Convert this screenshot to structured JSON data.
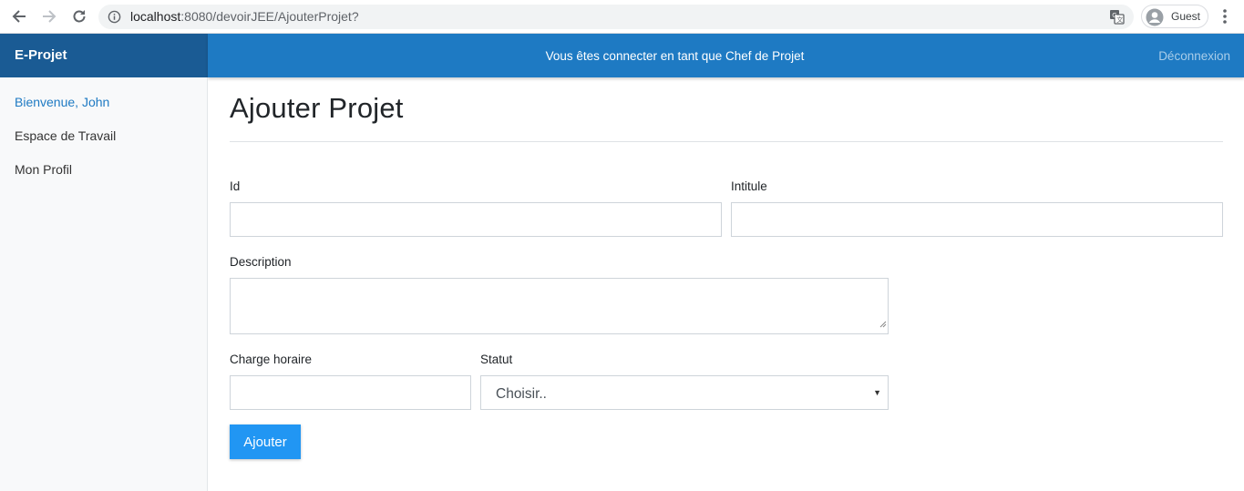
{
  "browser": {
    "url_host": "localhost",
    "url_path": ":8080/devoirJEE/AjouterProjet?",
    "profile_name": "Guest",
    "icons": [
      "back-arrow-icon",
      "forward-arrow-icon",
      "reload-icon",
      "info-icon",
      "translate-icon",
      "profile-avatar-icon",
      "more-menu-icon"
    ]
  },
  "app": {
    "brand": "E-Projet",
    "banner": "Vous êtes connecter en tant que Chef de Projet",
    "logout": "Déconnexion"
  },
  "sidebar": {
    "items": [
      {
        "label": "Bienvenue, John",
        "color": "#1e7ac3"
      },
      {
        "label": "Espace de Travail",
        "color": "#333333"
      },
      {
        "label": "Mon Profil",
        "color": "#333333"
      }
    ]
  },
  "form": {
    "title": "Ajouter Projet",
    "id_label": "Id",
    "id_value": "",
    "intitule_label": "Intitule",
    "intitule_value": "",
    "description_label": "Description",
    "description_value": "",
    "charge_label": "Charge horaire",
    "charge_value": "",
    "statut_label": "Statut",
    "statut_selected": "Choisir..",
    "submit_label": "Ajouter"
  },
  "colors": {
    "brand_bg": "#1a5b94",
    "topbar_bg": "#1e7ac3",
    "button_bg": "#2196f3"
  }
}
